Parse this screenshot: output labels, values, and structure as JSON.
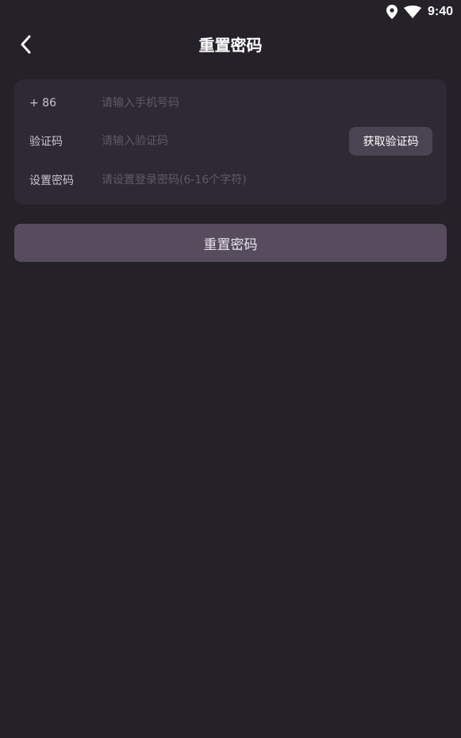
{
  "status_bar": {
    "time": "9:40",
    "icons": [
      "location-pin-icon",
      "wifi-icon"
    ]
  },
  "header": {
    "title": "重置密码",
    "back_icon": "chevron-left-icon"
  },
  "form": {
    "phone": {
      "label": "+ 86",
      "value": "",
      "placeholder": "请输入手机号码"
    },
    "code": {
      "label": "验证码",
      "value": "",
      "placeholder": "请输入验证码",
      "button_label": "获取验证码"
    },
    "password": {
      "label": "设置密码",
      "value": "",
      "placeholder": "请设置登录密码(6-16个字符)"
    }
  },
  "submit": {
    "label": "重置密码"
  },
  "colors": {
    "background": "#242128",
    "card": "#2e2a33",
    "code_button": "#4a4452",
    "submit_button": "#564c5e"
  }
}
